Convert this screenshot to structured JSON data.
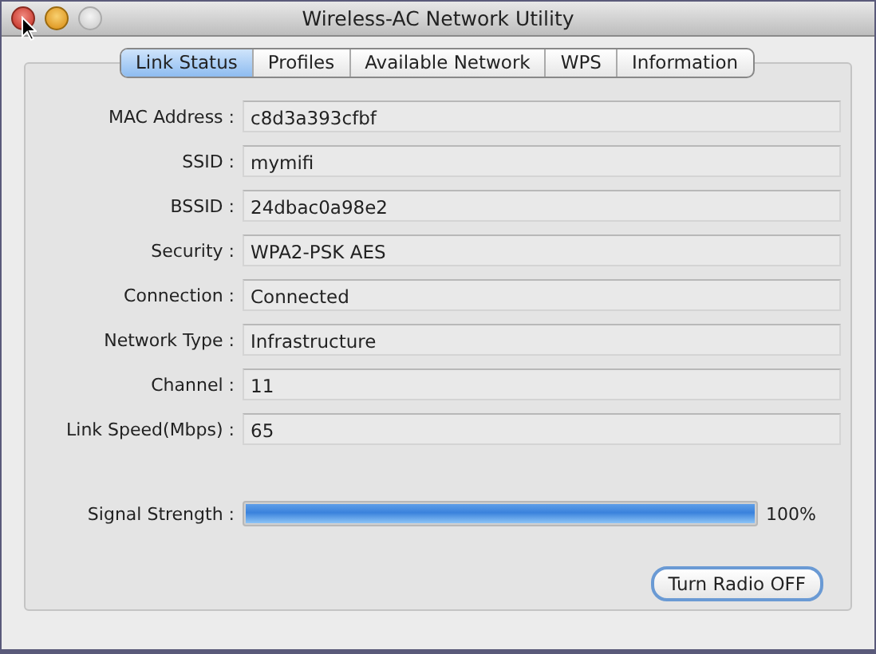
{
  "window": {
    "title": "Wireless-AC Network Utility"
  },
  "tabs": [
    {
      "label": "Link Status",
      "selected": true
    },
    {
      "label": "Profiles",
      "selected": false
    },
    {
      "label": "Available Network",
      "selected": false
    },
    {
      "label": "WPS",
      "selected": false
    },
    {
      "label": "Information",
      "selected": false
    }
  ],
  "fields": [
    {
      "label": "MAC Address :",
      "value": "c8d3a393cfbf"
    },
    {
      "label": "SSID :",
      "value": "mymifi"
    },
    {
      "label": "BSSID :",
      "value": "24dbac0a98e2"
    },
    {
      "label": "Security :",
      "value": "WPA2-PSK AES"
    },
    {
      "label": "Connection :",
      "value": "Connected"
    },
    {
      "label": "Network Type :",
      "value": "Infrastructure"
    },
    {
      "label": "Channel :",
      "value": "11"
    },
    {
      "label": "Link Speed(Mbps) :",
      "value": "65"
    }
  ],
  "signal": {
    "label": "Signal Strength :",
    "level": 1.0,
    "reading": "100%"
  },
  "buttons": [
    {
      "label": "Turn Radio OFF",
      "default": true
    }
  ]
}
